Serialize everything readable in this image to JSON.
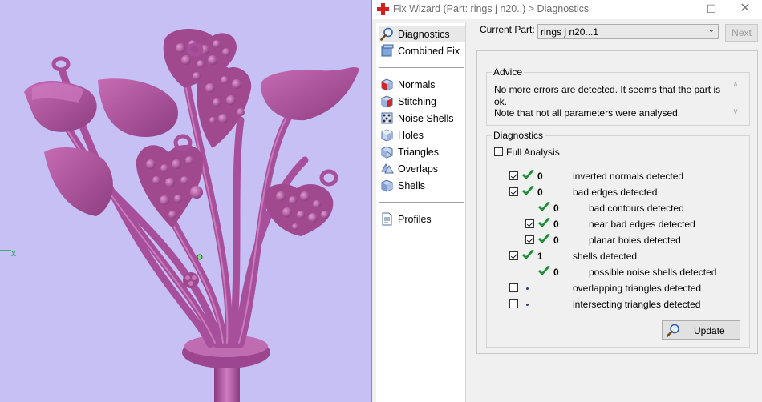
{
  "viewport": {
    "axis_label": "x",
    "colors": {
      "background": "#c6c0f5",
      "model": "#b45ca6",
      "axis": "#1aa64a"
    }
  },
  "window": {
    "title": "Fix Wizard (Part: rings j n20..) > Diagnostics",
    "controls": [
      "minimize",
      "maximize",
      "close"
    ]
  },
  "nav": {
    "items": [
      {
        "label": "Diagnostics",
        "icon": "magnifier-icon"
      },
      {
        "label": "Combined Fix",
        "icon": "combined-fix-icon"
      },
      {
        "label": "Normals",
        "icon": "normals-cube-icon"
      },
      {
        "label": "Stitching",
        "icon": "stitching-cube-icon"
      },
      {
        "label": "Noise Shells",
        "icon": "noise-shells-icon"
      },
      {
        "label": "Holes",
        "icon": "holes-cube-icon"
      },
      {
        "label": "Triangles",
        "icon": "triangles-cube-icon"
      },
      {
        "label": "Overlaps",
        "icon": "overlaps-icon"
      },
      {
        "label": "Shells",
        "icon": "shells-cube-icon"
      },
      {
        "label": "Profiles",
        "icon": "profiles-document-icon"
      }
    ],
    "selected": "Diagnostics"
  },
  "header": {
    "current_part_label": "Current Part:",
    "current_part_value": "rings j n20...1",
    "next_label": "Next"
  },
  "advice": {
    "title": "Advice",
    "line1": "No more errors are detected. It seems that the part is ok.",
    "line2": "Note that not all parameters were analysed."
  },
  "diagnostics": {
    "title": "Diagnostics",
    "full_analysis_label": "Full Analysis",
    "full_analysis_checked": false,
    "rows": [
      {
        "checkbox": true,
        "checked": true,
        "status": "ok",
        "count": "0",
        "label": "inverted normals detected",
        "indent": 0
      },
      {
        "checkbox": true,
        "checked": true,
        "status": "ok",
        "count": "0",
        "label": "bad edges detected",
        "indent": 0
      },
      {
        "checkbox": false,
        "checked": false,
        "status": "ok",
        "count": "0",
        "label": "bad contours detected",
        "indent": 1
      },
      {
        "checkbox": true,
        "checked": true,
        "status": "ok",
        "count": "0",
        "label": "near bad edges detected",
        "indent": 1
      },
      {
        "checkbox": true,
        "checked": true,
        "status": "ok",
        "count": "0",
        "label": "planar holes detected",
        "indent": 1
      },
      {
        "checkbox": true,
        "checked": true,
        "status": "ok",
        "count": "1",
        "label": "shells detected",
        "indent": 0
      },
      {
        "checkbox": false,
        "checked": false,
        "status": "ok",
        "count": "0",
        "label": "possible noise shells detected",
        "indent": 1
      },
      {
        "checkbox": true,
        "checked": false,
        "status": "not-analysed",
        "count": "",
        "label": "overlapping triangles detected",
        "indent": 0
      },
      {
        "checkbox": true,
        "checked": false,
        "status": "not-analysed",
        "count": "",
        "label": "intersecting triangles detected",
        "indent": 0
      }
    ],
    "update_label": "Update"
  }
}
